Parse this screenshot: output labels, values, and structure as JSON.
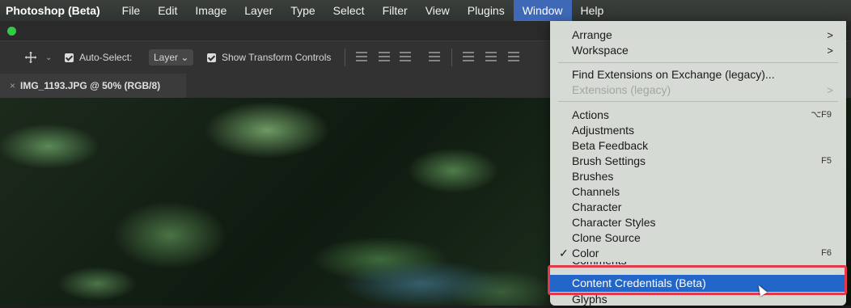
{
  "menubar": {
    "app": "Photoshop (Beta)",
    "items": [
      "File",
      "Edit",
      "Image",
      "Layer",
      "Type",
      "Select",
      "Filter",
      "View",
      "Plugins",
      "Window",
      "Help"
    ],
    "active": "Window"
  },
  "options": {
    "auto_select_label": "Auto-Select:",
    "auto_select_value": "Layer",
    "show_transform_label": "Show Transform Controls"
  },
  "document_tab": {
    "close": "×",
    "title": "IMG_1193.JPG @ 50% (RGB/8)"
  },
  "window_menu": {
    "arrange": "Arrange",
    "workspace": "Workspace",
    "find_extensions": "Find Extensions on Exchange (legacy)...",
    "extensions_legacy": "Extensions (legacy)",
    "actions": "Actions",
    "actions_shortcut": "⌥F9",
    "adjustments": "Adjustments",
    "beta_feedback": "Beta Feedback",
    "brush_settings": "Brush Settings",
    "brush_settings_shortcut": "F5",
    "brushes": "Brushes",
    "channels": "Channels",
    "character": "Character",
    "character_styles": "Character Styles",
    "clone_source": "Clone Source",
    "color": "Color",
    "color_shortcut": "F6",
    "comments": "Comments",
    "content_credentials": "Content Credentials (Beta)",
    "glyphs": "Glyphs",
    "submenu_arrow": ">",
    "checkmark": "✓"
  }
}
